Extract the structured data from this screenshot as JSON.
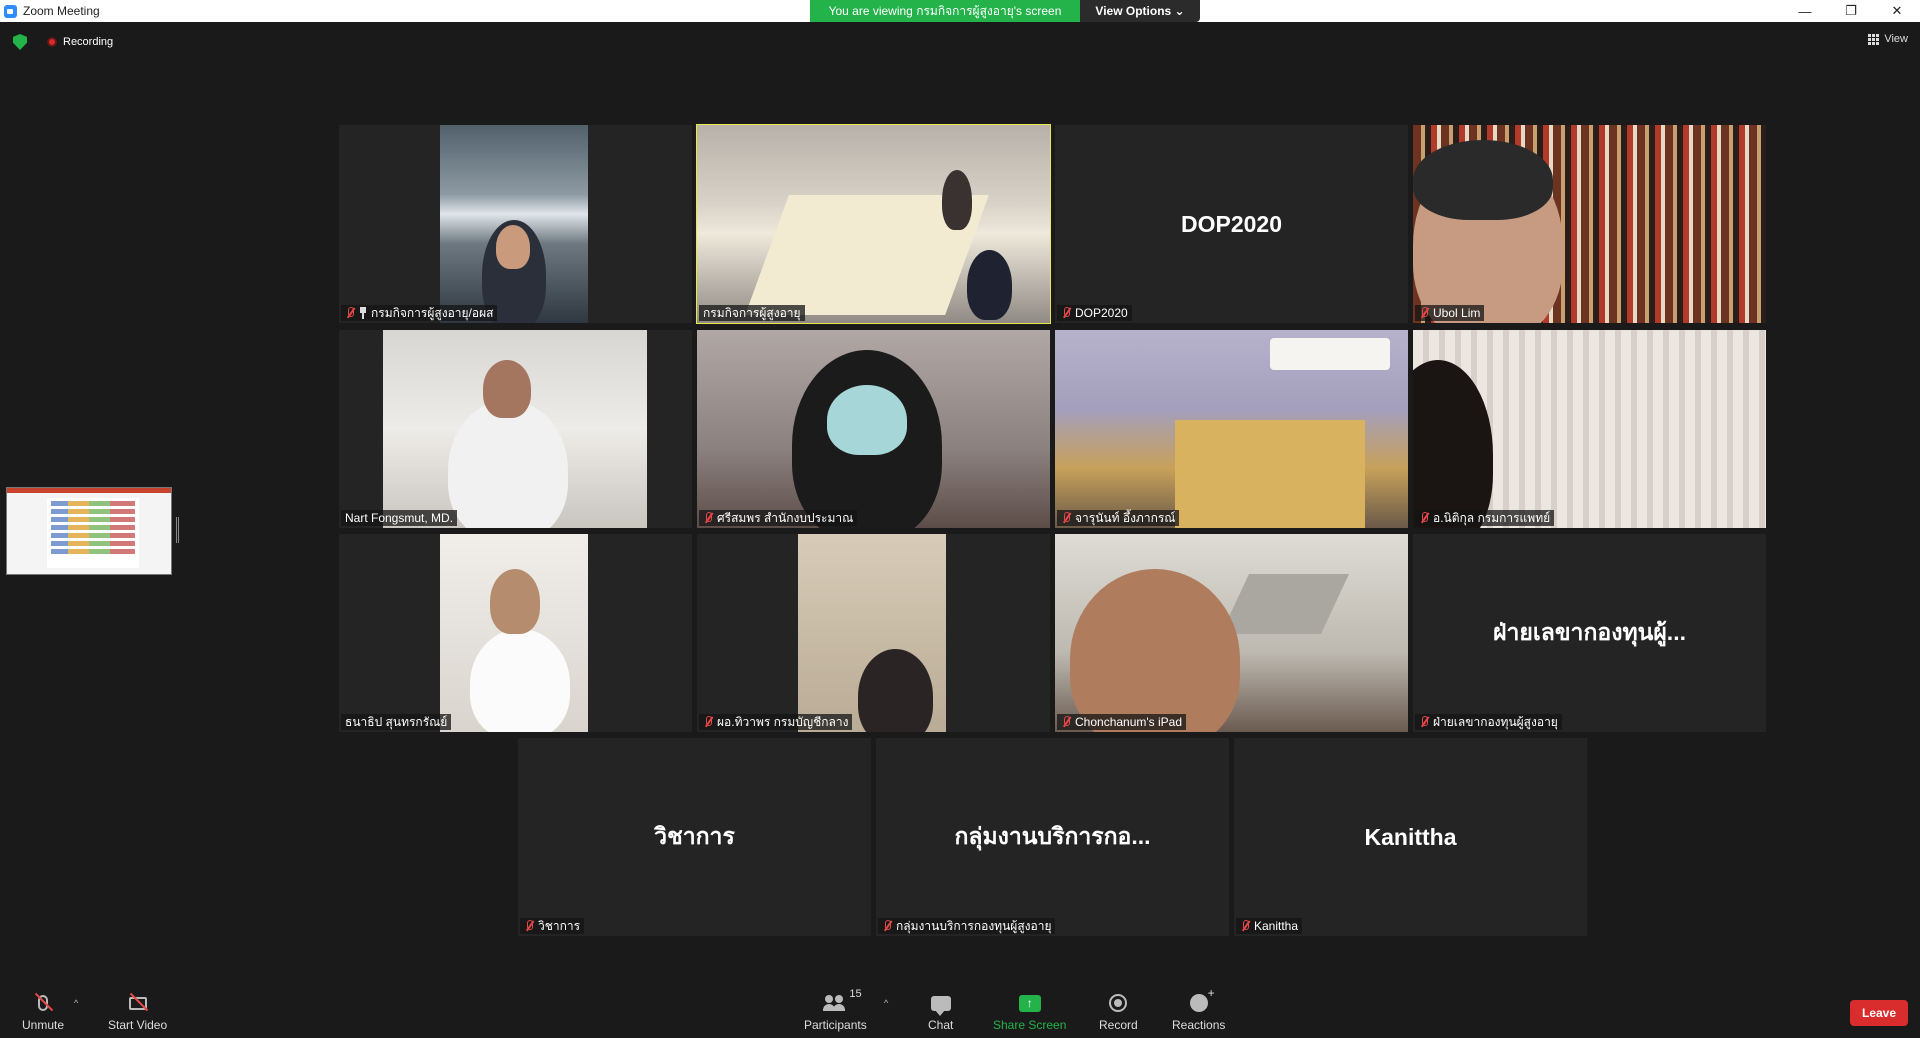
{
  "window": {
    "title": "Zoom Meeting",
    "controls": {
      "minimize": "—",
      "restore": "❐",
      "close": "✕"
    }
  },
  "banner": {
    "viewing_text": "You are viewing กรมกิจการผู้สูงอายุ's screen",
    "view_options": "View Options ⌄"
  },
  "status": {
    "recording_label": "Recording",
    "view_label": "View"
  },
  "tiles": [
    {
      "name": "กรมกิจการผู้สูงอายุ/อผส",
      "muted": true,
      "pinned": true,
      "video": true
    },
    {
      "name": "กรมกิจการผู้สูงอายุ",
      "muted": false,
      "active_speaker": true,
      "video": true
    },
    {
      "name": "DOP2020",
      "muted": true,
      "video": false,
      "display_name": "DOP2020"
    },
    {
      "name": "Ubol Lim",
      "muted": true,
      "video": true
    },
    {
      "name": "Nart Fongsmut, MD.",
      "muted": false,
      "video": true
    },
    {
      "name": "ศรีสมพร สำนักงบประมาณ",
      "muted": true,
      "video": true
    },
    {
      "name": "จารุนันท์ อึ้งภากรณ์",
      "muted": true,
      "video": true
    },
    {
      "name": "อ.นิติกุล กรมการแพทย์",
      "muted": true,
      "video": true
    },
    {
      "name": "ธนาธิป สุนทรกรัณย์",
      "muted": false,
      "video": true
    },
    {
      "name": "ผอ.ทิวาพร กรมบัญชีกลาง",
      "muted": true,
      "video": true
    },
    {
      "name": "Chonchanum's iPad",
      "muted": true,
      "video": true
    },
    {
      "name": "ฝ่ายเลขากองทุนผู้สูงอายุ",
      "muted": true,
      "video": false,
      "display_name": "ฝ่ายเลขากองทุนผู้..."
    },
    {
      "name": "วิชาการ",
      "muted": true,
      "video": false,
      "display_name": "วิชาการ"
    },
    {
      "name": "กลุ่มงานบริการกองทุนผู้สูงอายุ",
      "muted": true,
      "video": false,
      "display_name": "กลุ่มงานบริการกอ..."
    },
    {
      "name": "Kanittha",
      "muted": true,
      "video": false,
      "display_name": "Kanittha"
    }
  ],
  "toolbar": {
    "unmute": "Unmute",
    "start_video": "Start Video",
    "participants": "Participants",
    "participants_count": "15",
    "chat": "Chat",
    "share_screen": "Share Screen",
    "record": "Record",
    "reactions": "Reactions",
    "leave": "Leave"
  },
  "colors": {
    "banner_green": "#23b34a",
    "active_speaker_border": "#e8e84a",
    "leave_red": "#d92d2d",
    "mute_red": "#e54848"
  }
}
